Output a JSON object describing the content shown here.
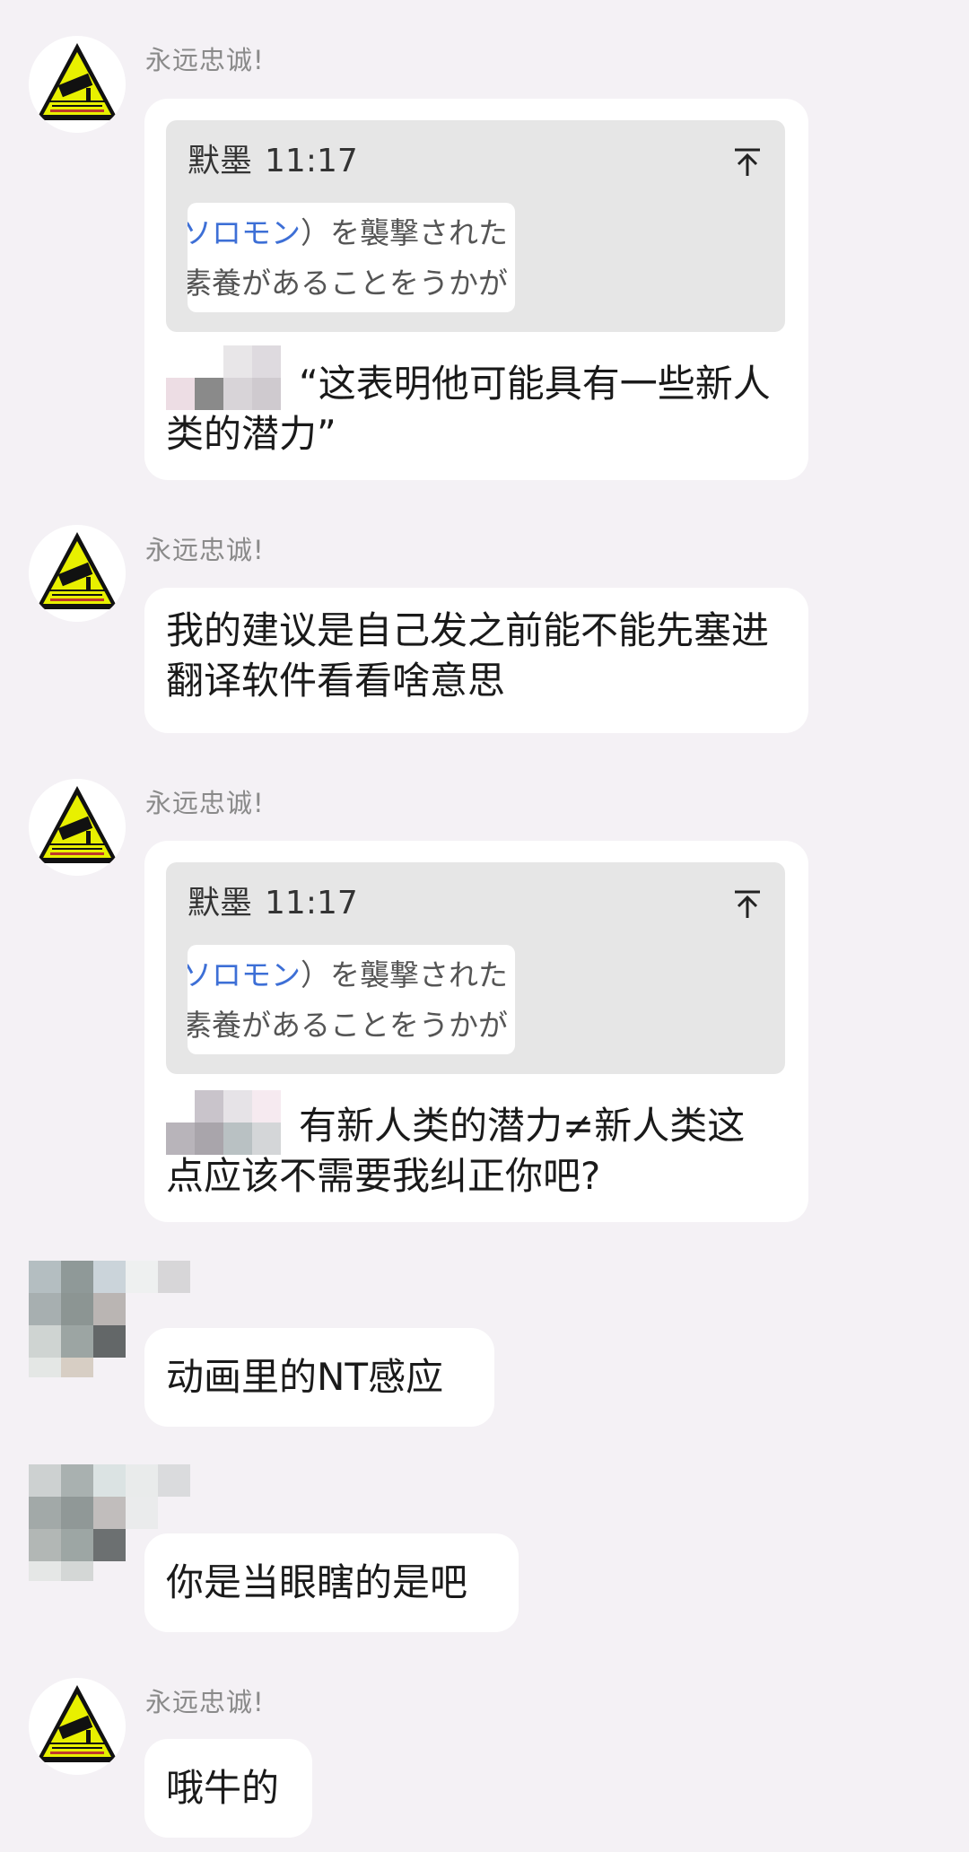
{
  "messages": [
    {
      "sender": "永远忠诚!",
      "quote": {
        "author": "默墨",
        "time": "11:17",
        "thumb_line1_blue": "ソロモン",
        "thumb_line1_rest": "）を襲撃された",
        "thumb_line2": "素養があることをうかが"
      },
      "text": "“这表明他可能具有一些新人类的潜力”"
    },
    {
      "sender": "永远忠诚!",
      "text": "我的建议是自己发之前能不能先塞进翻译软件看看啥意思"
    },
    {
      "sender": "永远忠诚!",
      "quote": {
        "author": "默墨",
        "time": "11:17",
        "thumb_line1_blue": "ソロモン",
        "thumb_line1_rest": "）を襲撃された",
        "thumb_line2": "素養があることをうかが"
      },
      "text": "有新人类的潜力≠新人类这点应该不需要我纠正你吧?"
    },
    {
      "text": "动画里的NT感应"
    },
    {
      "text": "你是当眼瞎的是吧"
    },
    {
      "sender": "永远忠诚!",
      "text": "哦牛的"
    }
  ],
  "avatar_badge": {
    "icon": "cctv-warning-sign-icon",
    "color_yellow": "#e8f000",
    "color_black": "#111111"
  },
  "icons": {
    "pin": "pin-to-top-icon"
  }
}
